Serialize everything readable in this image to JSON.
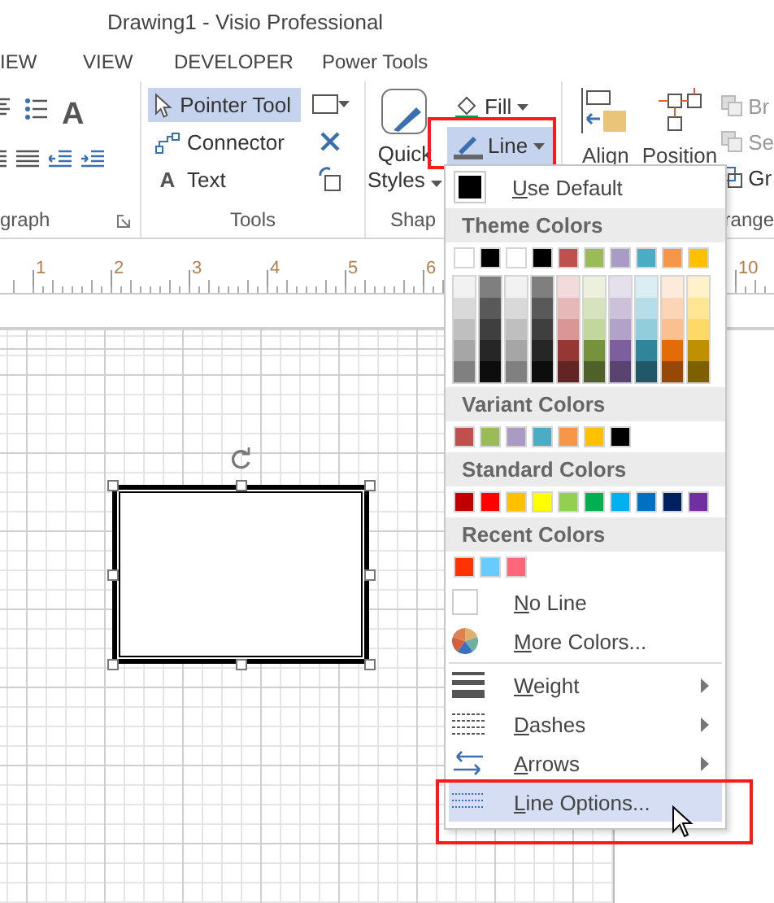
{
  "window": {
    "title": "Drawing1 - Visio Professional"
  },
  "tabs": [
    {
      "label": "IEW",
      "selected": false
    },
    {
      "label": "VIEW",
      "selected": false
    },
    {
      "label": "DEVELOPER",
      "selected": false
    },
    {
      "label": "Power Tools",
      "selected": false
    }
  ],
  "ribbon": {
    "paragraph": {
      "label": "graph",
      "glyph": "A"
    },
    "tools": {
      "label": "Tools",
      "items": [
        {
          "label": "Pointer Tool",
          "selected": true,
          "kind": "pointer"
        },
        {
          "label": "Connector",
          "selected": false,
          "kind": "connector"
        },
        {
          "label": "Text",
          "selected": false,
          "kind": "text",
          "glyph": "A"
        }
      ]
    },
    "shape_styles": {
      "label": "Shap",
      "quick_styles": [
        "Quick",
        "Styles"
      ],
      "fill": {
        "label": "Fill",
        "selected": false
      },
      "line": {
        "label": "Line",
        "selected": true
      }
    },
    "arrange": {
      "label": "range",
      "align": "Align",
      "position": "Position",
      "small": [
        "Br",
        "Se",
        "Gr"
      ]
    }
  },
  "ruler": {
    "labels": [
      "1",
      "2",
      "3",
      "4",
      "5",
      "6"
    ],
    "far_label": "10"
  },
  "shape": {
    "selected": true
  },
  "line_menu": {
    "use_default": {
      "label": "Use Default",
      "color": "#000000"
    },
    "sections": [
      {
        "title": "Theme Colors",
        "swatches": [
          {
            "color": "#ffffff"
          },
          {
            "color": "#000000"
          },
          {
            "color": "#ffffff"
          },
          {
            "color": "#000000"
          },
          {
            "color": "#c0504d"
          },
          {
            "color": "#9bbb59"
          },
          {
            "color": "#a99bc3"
          },
          {
            "color": "#4bacc6"
          },
          {
            "color": "#f79646"
          },
          {
            "color": "#ffc000"
          }
        ],
        "shades": [
          [
            {
              "color": "#f2f2f2"
            },
            {
              "color": "#d9d9d9"
            },
            {
              "color": "#bfbfbf"
            },
            {
              "color": "#a6a6a6"
            },
            {
              "color": "#808080"
            }
          ],
          [
            {
              "color": "#7f7f7f"
            },
            {
              "color": "#595959"
            },
            {
              "color": "#3f3f3f"
            },
            {
              "color": "#262626"
            },
            {
              "color": "#0d0d0d"
            }
          ],
          [
            {
              "color": "#f2f2f2"
            },
            {
              "color": "#d9d9d9"
            },
            {
              "color": "#bfbfbf"
            },
            {
              "color": "#a6a6a6"
            },
            {
              "color": "#808080"
            }
          ],
          [
            {
              "color": "#7f7f7f"
            },
            {
              "color": "#595959"
            },
            {
              "color": "#3f3f3f"
            },
            {
              "color": "#262626"
            },
            {
              "color": "#0d0d0d"
            }
          ],
          [
            {
              "color": "#f2dcdb"
            },
            {
              "color": "#e6b9b8"
            },
            {
              "color": "#d99694"
            },
            {
              "color": "#953734"
            },
            {
              "color": "#632523"
            }
          ],
          [
            {
              "color": "#ebf1dd"
            },
            {
              "color": "#d7e3bc"
            },
            {
              "color": "#c3d69b"
            },
            {
              "color": "#76923c"
            },
            {
              "color": "#4f6128"
            }
          ],
          [
            {
              "color": "#e5e0ec"
            },
            {
              "color": "#ccc1d9"
            },
            {
              "color": "#b2a2c7"
            },
            {
              "color": "#7d5f9e"
            },
            {
              "color": "#58446f"
            }
          ],
          [
            {
              "color": "#dbeef3"
            },
            {
              "color": "#b7dde8"
            },
            {
              "color": "#92cddc"
            },
            {
              "color": "#31859b"
            },
            {
              "color": "#205867"
            }
          ],
          [
            {
              "color": "#fdeada"
            },
            {
              "color": "#fbd5b5"
            },
            {
              "color": "#fac08f"
            },
            {
              "color": "#e36c09"
            },
            {
              "color": "#974806"
            }
          ],
          [
            {
              "color": "#fff2ca"
            },
            {
              "color": "#ffe694"
            },
            {
              "color": "#ffd965"
            },
            {
              "color": "#bf9000"
            },
            {
              "color": "#7f6000"
            }
          ]
        ]
      },
      {
        "title": "Variant Colors",
        "swatches": [
          {
            "color": "#c0504d"
          },
          {
            "color": "#9bbb59"
          },
          {
            "color": "#a99bc3"
          },
          {
            "color": "#4bacc6"
          },
          {
            "color": "#f79646"
          },
          {
            "color": "#ffc000"
          },
          {
            "color": "#000000"
          }
        ]
      },
      {
        "title": "Standard Colors",
        "swatches": [
          {
            "color": "#c00000"
          },
          {
            "color": "#ff0000"
          },
          {
            "color": "#ffc000"
          },
          {
            "color": "#ffff00"
          },
          {
            "color": "#92d050"
          },
          {
            "color": "#00b050"
          },
          {
            "color": "#00b0f0"
          },
          {
            "color": "#0070c0"
          },
          {
            "color": "#002060"
          },
          {
            "color": "#7030a0"
          }
        ]
      },
      {
        "title": "Recent Colors",
        "swatches": [
          {
            "color": "#ff3300"
          },
          {
            "color": "#66ccff"
          },
          {
            "color": "#ff6677"
          }
        ]
      }
    ],
    "color_actions": [
      {
        "label": "No Line",
        "kind": "none"
      },
      {
        "label": "More Colors...",
        "kind": "more"
      }
    ],
    "items": [
      {
        "label": "Weight",
        "kind": "weight",
        "submenu": true,
        "selected": false
      },
      {
        "label": "Dashes",
        "kind": "dashes",
        "submenu": true,
        "selected": false
      },
      {
        "label": "Arrows",
        "kind": "arrows",
        "submenu": true,
        "selected": false
      },
      {
        "label": "Line Options...",
        "kind": "options",
        "submenu": false,
        "selected": true
      }
    ]
  }
}
